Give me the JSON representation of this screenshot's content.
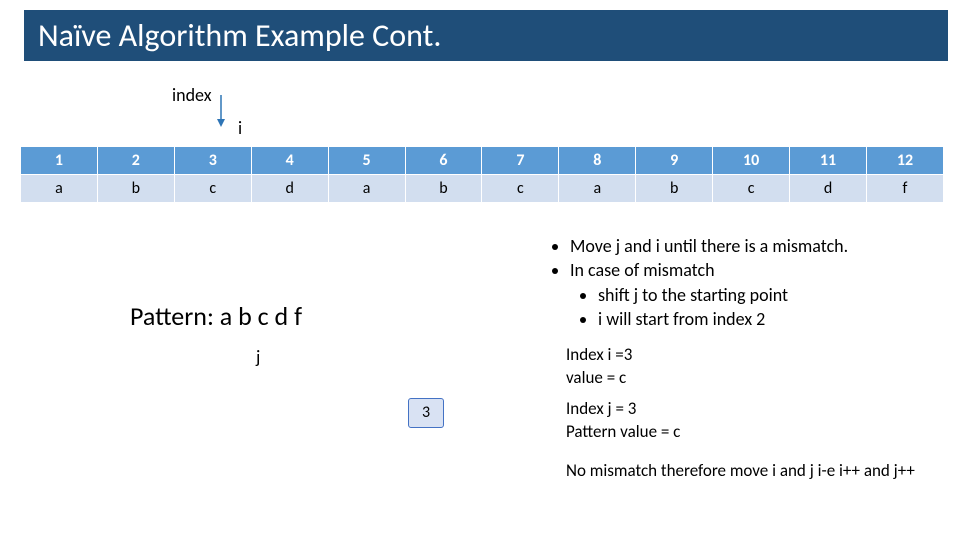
{
  "title": "Naïve Algorithm Example Cont.",
  "index_label": "index",
  "i_label": "i",
  "table": {
    "headers": [
      "1",
      "2",
      "3",
      "4",
      "5",
      "6",
      "7",
      "8",
      "9",
      "10",
      "11",
      "12"
    ],
    "cells": [
      "a",
      "b",
      "c",
      "d",
      "a",
      "b",
      "c",
      "a",
      "b",
      "c",
      "d",
      "f"
    ]
  },
  "pattern_label": "Pattern: a b c d f",
  "j_label": "j",
  "j_box_value": "3",
  "bullets": {
    "b1": "Move j and i until there is a mismatch.",
    "b2": "In case of mismatch",
    "b2a": "shift j to the starting point",
    "b2b": "i will start from index 2"
  },
  "info_i": {
    "line1": "Index i =3",
    "line2": "value = c"
  },
  "info_j": {
    "line1": "Index j = 3",
    "line2": "Pattern value = c"
  },
  "conclusion": "No mismatch therefore move i and j i-e i++ and j++"
}
